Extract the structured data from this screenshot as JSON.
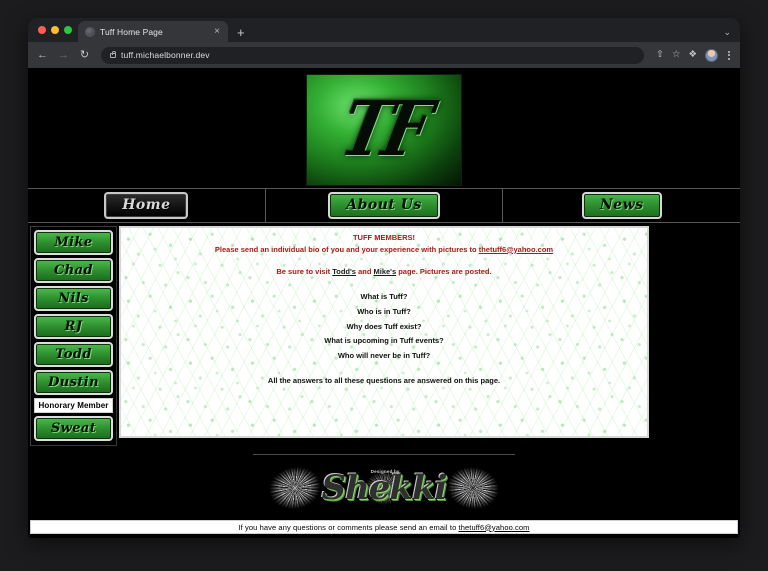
{
  "browser": {
    "tab": {
      "title": "Tuff Home Page",
      "close_label": "×"
    },
    "new_tab_label": "+",
    "tabstrip_chevron": "⌄",
    "back_label": "←",
    "forward_label": "→",
    "reload_label": "↻",
    "url": "tuff.michaelbonner.dev",
    "share_label": "⇧",
    "bookmark_label": "☆",
    "extensions_label": "❖"
  },
  "page": {
    "logo_text": "TF",
    "nav": [
      {
        "label": "Home",
        "style": "silver"
      },
      {
        "label": "About Us",
        "style": "green"
      },
      {
        "label": "News",
        "style": "green"
      }
    ],
    "members": [
      {
        "label": "Mike"
      },
      {
        "label": "Chad"
      },
      {
        "label": "Nils"
      },
      {
        "label": "RJ"
      },
      {
        "label": "Todd"
      },
      {
        "label": "Dustin"
      }
    ],
    "honorary_label": "Honorary Member",
    "honorary_members": [
      {
        "label": "Sweat"
      }
    ],
    "content": {
      "heading": "TUFF MEMBERS!",
      "bio_request_prefix": "Please send an individual bio of you and your experience with pictures to ",
      "bio_email": "thetuff6@yahoo.com",
      "visit_prefix": "Be sure to visit ",
      "visit_link_1": "Todd's",
      "visit_mid": " and ",
      "visit_link_2": "Mike's",
      "visit_suffix": " page. Pictures are posted.",
      "questions": [
        "What is Tuff?",
        "Who is in Tuff?",
        "Why does Tuff exist?",
        "What is upcoming in Tuff events?",
        "Who will never be in Tuff?"
      ],
      "answer_line": "All the answers to all these questions are answered on this page."
    },
    "credit": {
      "designer": "Shekki",
      "designed_by": "Designed by"
    },
    "footer": {
      "text_prefix": "If you have any questions or comments please send an email to ",
      "email": "thetuff6@yahoo.com"
    }
  },
  "colors": {
    "accent_green": "#2f9130",
    "alert_red": "#b01818",
    "page_bg": "#000000"
  }
}
